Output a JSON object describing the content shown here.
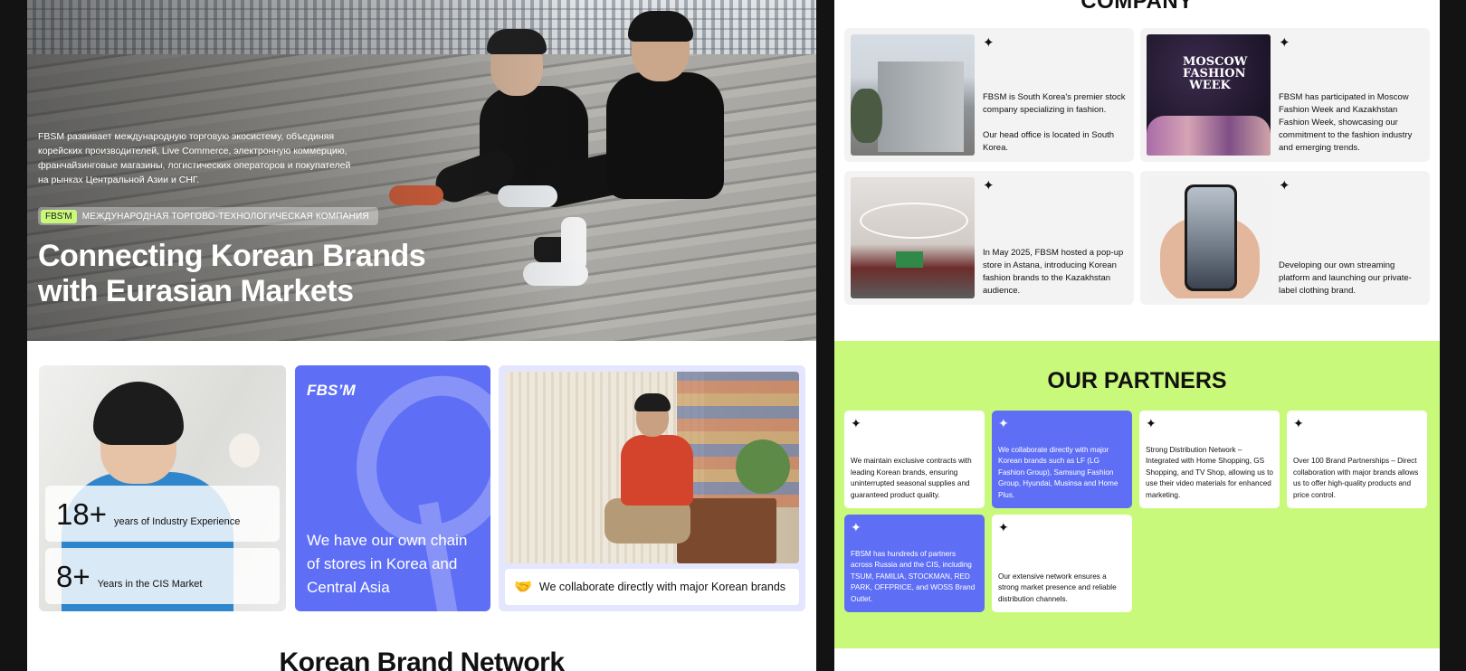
{
  "hero": {
    "description": "FBSM развивает международную торговую экосистему, объединяя корейских производителей, Live Commerce, электронную коммерцию, франчайзинговые магазины, логистических операторов и покупателей на рынках Центральной Азии и СНГ.",
    "badge_tag": "FBS'M",
    "badge_text": "МЕЖДУНАРОДНАЯ ТОРГОВО-ТЕХНОЛОГИЧЕСКАЯ КОМПАНИЯ",
    "title": "Connecting Korean Brands with Eurasian Markets"
  },
  "stats": [
    {
      "number": "18+",
      "label": "years of Industry Experience"
    },
    {
      "number": "8+",
      "label": "Years in the CIS Market"
    }
  ],
  "stores_card": {
    "logo": "FBS’M",
    "message": "We have our own chain of stores in Korea and Central Asia"
  },
  "collab_card": {
    "icon": "handshake-icon",
    "text": "We collaborate directly with major Korean brands"
  },
  "network": {
    "title": "Korean Brand Network"
  },
  "company": {
    "title": "COMPANY",
    "cards": [
      {
        "text": "FBSM is South Korea's premier stock company specializing in fashion.\n\nOur head office is located in South Korea."
      },
      {
        "image_label": "MOSCOW FASHION WEEK",
        "text": "FBSM has participated in Moscow Fashion Week and Kazakhstan Fashion Week, showcasing our commitment to the fashion industry and emerging trends."
      },
      {
        "text": "In May 2025, FBSM hosted a pop-up store in Astana, introducing Korean fashion brands to the Kazakhstan audience."
      },
      {
        "text": "Developing our own streaming platform and launching our private-label clothing brand."
      }
    ]
  },
  "partners": {
    "title": "OUR PARTNERS",
    "cards": [
      {
        "text": "We maintain exclusive contracts with leading Korean brands, ensuring uninterrupted seasonal supplies and guaranteed product quality.",
        "style": "white"
      },
      {
        "text": "We collaborate directly with major Korean brands such as LF (LG Fashion Group), Samsung Fashion Group, Hyundai, Musinsa and Home Plus.",
        "style": "blue"
      },
      {
        "text": "Strong Distribution Network – Integrated with Home Shopping, GS Shopping, and TV Shop, allowing us to use their video materials for enhanced marketing.",
        "style": "white"
      },
      {
        "text": "Over 100 Brand Partnerships – Direct collaboration with major brands allows us to offer high-quality products and price control.",
        "style": "white"
      },
      {
        "text": "FBSM has hundreds of partners across Russia and the CIS, including TSUM, FAMILIA, STOCKMAN, RED PARK, OFFPRICE, and WOSS Brand Outlet.",
        "style": "blue"
      },
      {
        "text": "Our extensive network ensures a strong market presence and reliable distribution channels.",
        "style": "white"
      }
    ]
  },
  "icons": {
    "spark": "sparkle-icon"
  },
  "colors": {
    "accent_blue": "#5f6ff5",
    "accent_lime": "#c9f97a",
    "card_bg": "#f3f3f3"
  }
}
